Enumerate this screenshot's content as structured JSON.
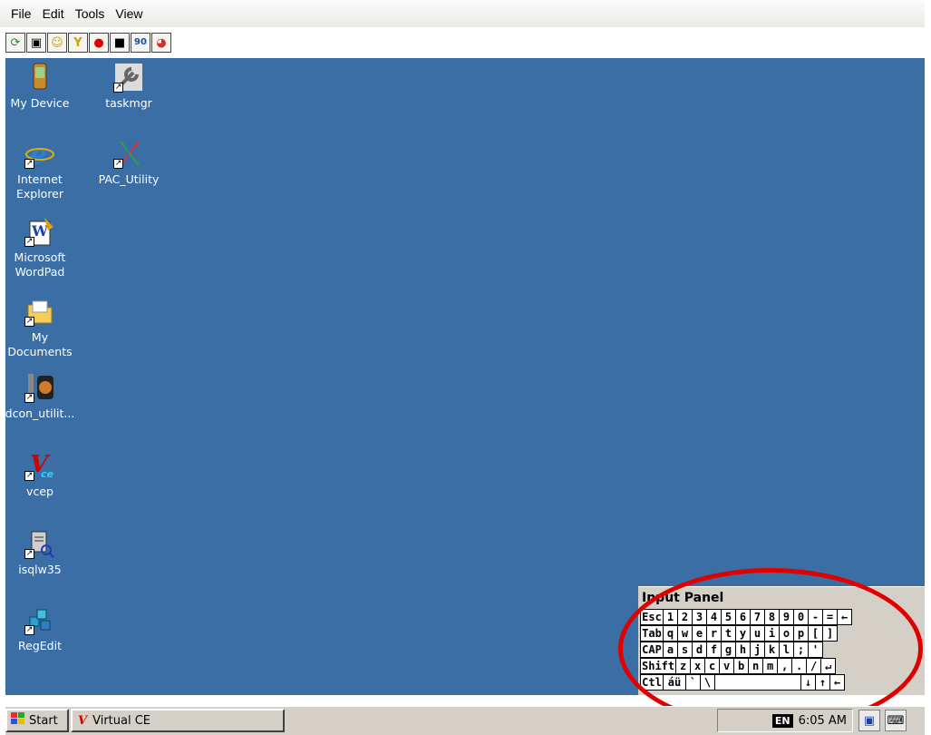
{
  "menubar": {
    "items": [
      "File",
      "Edit",
      "Tools",
      "View"
    ]
  },
  "toolbar": {
    "buttons": [
      {
        "name": "refresh-icon",
        "glyph": "⟳",
        "color": "#2a8a2a"
      },
      {
        "name": "screenshot-icon",
        "glyph": "▣",
        "color": "#333"
      },
      {
        "name": "smiley-icon",
        "glyph": "☺",
        "color": "#c9a400"
      },
      {
        "name": "connect-icon",
        "glyph": "Y",
        "color": "#c9a400"
      },
      {
        "name": "record-icon",
        "glyph": "●",
        "color": "#e00000"
      },
      {
        "name": "stop-icon",
        "glyph": "■",
        "color": "#000"
      },
      {
        "name": "rotate-90-icon",
        "glyph": "90",
        "color": "#1a4fb0"
      },
      {
        "name": "color-wheel-icon",
        "glyph": "◕",
        "color": "#d03030"
      }
    ]
  },
  "desktop": {
    "icons": [
      {
        "label": "My Device"
      },
      {
        "label": "taskmgr"
      },
      {
        "label": "Internet Explorer"
      },
      {
        "label": "PAC_Utility"
      },
      {
        "label": "Microsoft WordPad"
      },
      {
        "label": "My Documents"
      },
      {
        "label": "dcon_utilit..."
      },
      {
        "label": "vcep"
      },
      {
        "label": "isqlw35"
      },
      {
        "label": "RegEdit"
      }
    ]
  },
  "input_panel": {
    "title": "Input Panel",
    "rows": [
      [
        "Esc",
        "1",
        "2",
        "3",
        "4",
        "5",
        "6",
        "7",
        "8",
        "9",
        "0",
        "-",
        "=",
        "←"
      ],
      [
        "Tab",
        "q",
        "w",
        "e",
        "r",
        "t",
        "y",
        "u",
        "i",
        "o",
        "p",
        "[",
        "]"
      ],
      [
        "CAP",
        "a",
        "s",
        "d",
        "f",
        "g",
        "h",
        "j",
        "k",
        "l",
        ";",
        "'"
      ],
      [
        "Shift",
        "z",
        "x",
        "c",
        "v",
        "b",
        "n",
        "m",
        ",",
        ".",
        "/",
        "↵"
      ],
      [
        "Ctl",
        "áü",
        "`",
        "\\",
        " ",
        "↓",
        "↑",
        "←"
      ]
    ]
  },
  "taskbar": {
    "start_label": "Start",
    "task_label": "Virtual CE",
    "lang": "EN",
    "clock": "6:05 AM"
  },
  "colors": {
    "desktop": "#3a6ea5",
    "annotation": "#e00000"
  }
}
